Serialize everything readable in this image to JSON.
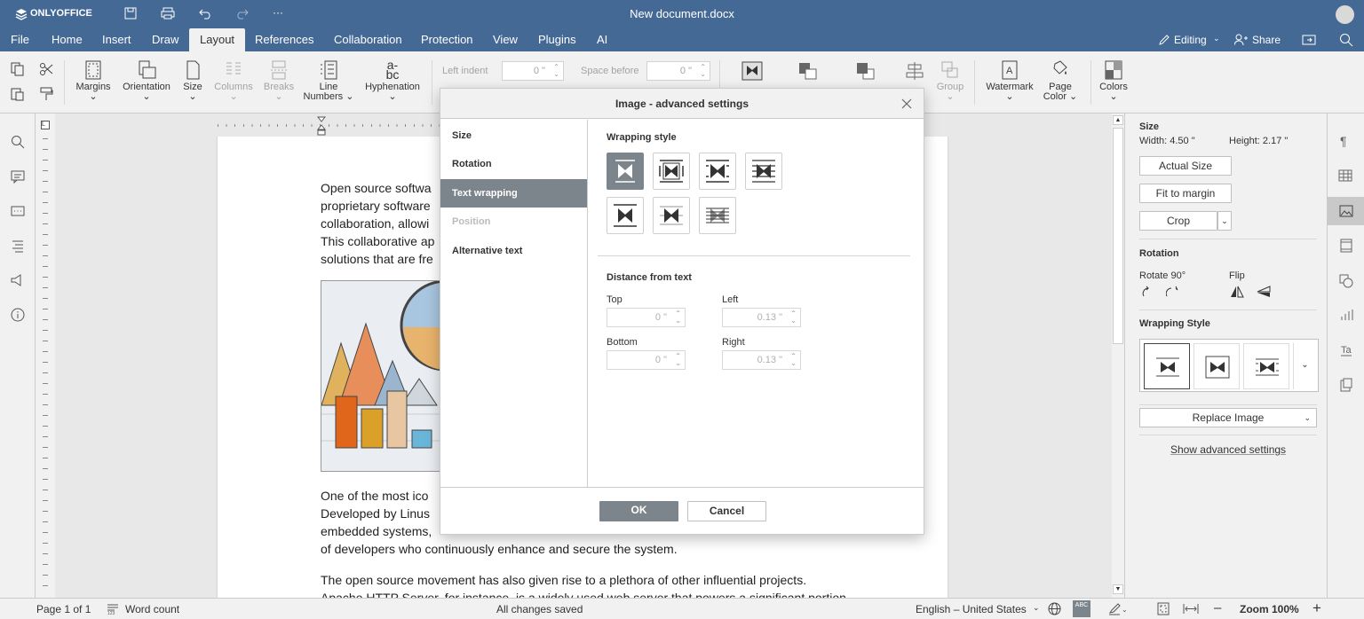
{
  "app": {
    "logo_text": "ONLYOFFICE",
    "title": "New document.docx"
  },
  "menu": {
    "items": [
      "File",
      "Home",
      "Insert",
      "Draw",
      "Layout",
      "References",
      "Collaboration",
      "Protection",
      "View",
      "Plugins",
      "AI"
    ],
    "active": "Layout",
    "editing": "Editing",
    "share": "Share"
  },
  "toolbar": {
    "margins": "Margins",
    "orientation": "Orientation",
    "size": "Size",
    "columns": "Columns",
    "breaks": "Breaks",
    "line_numbers_1": "Line",
    "line_numbers_2": "Numbers",
    "hyphenation": "Hyphenation",
    "left_indent": "Left indent",
    "left_indent_value": "0 \"",
    "space_before": "Space before",
    "space_before_value": "0 \"",
    "group": "Group",
    "watermark": "Watermark",
    "page_color_1": "Page",
    "page_color_2": "Color",
    "colors": "Colors"
  },
  "document": {
    "para1": [
      "Open source softwa",
      "proprietary software",
      "collaboration, allowi",
      "This collaborative ap",
      "solutions that are fre"
    ],
    "para2": [
      "One of the most ico",
      "Developed by Linus",
      "embedded systems,",
      "of developers who continuously enhance and secure the system."
    ],
    "para3": [
      "The open source movement has also given rise to a plethora of other influential projects.",
      "Apache HTTP Server, for instance, is a widely used web server that powers a significant portion"
    ]
  },
  "right_panel": {
    "size_title": "Size",
    "width": "Width: 4.50 \"",
    "height": "Height: 2.17 \"",
    "actual_size": "Actual Size",
    "fit_to_margin": "Fit to margin",
    "crop": "Crop",
    "rotation_title": "Rotation",
    "rotate_90": "Rotate 90°",
    "flip": "Flip",
    "wrapping_title": "Wrapping Style",
    "replace_image": "Replace Image",
    "show_advanced": "Show advanced settings"
  },
  "statusbar": {
    "page": "Page 1 of 1",
    "word_count": "Word count",
    "saved": "All changes saved",
    "language": "English – United States",
    "zoom": "Zoom 100%"
  },
  "dialog": {
    "title": "Image - advanced settings",
    "nav": [
      "Size",
      "Rotation",
      "Text wrapping",
      "Position",
      "Alternative text"
    ],
    "selected_nav": "Text wrapping",
    "wrapping_style_label": "Wrapping style",
    "distance_label": "Distance from text",
    "top_label": "Top",
    "top_value": "0 \"",
    "left_label": "Left",
    "left_value": "0.13 \"",
    "bottom_label": "Bottom",
    "bottom_value": "0 \"",
    "right_label": "Right",
    "right_value": "0.13 \"",
    "ok": "OK",
    "cancel": "Cancel"
  },
  "colors": {
    "header": "#446995",
    "selected": "#7d858c",
    "ok_button": "#7d858c"
  }
}
